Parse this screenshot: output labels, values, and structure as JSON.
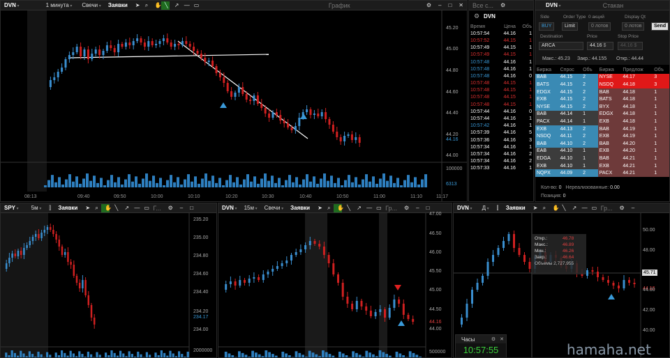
{
  "main": {
    "symbol": "DVN",
    "interval": "1 минута",
    "chart_type": "Свечи",
    "orders": "Заявки",
    "title": "График",
    "prices": [
      "45.20",
      "45.00",
      "44.80",
      "44.60",
      "44.40",
      "44.20",
      "44.00"
    ],
    "last_price": "44.16",
    "volume_labels": [
      "100000",
      "6313"
    ],
    "times": [
      "08:13",
      "09:40",
      "09:50",
      "10:00",
      "10:10",
      "10:20",
      "10:30",
      "10:40",
      "10:50",
      "11:00",
      "11:10",
      "11:17"
    ]
  },
  "tape": {
    "symbol": "DVN",
    "title": "Все с...",
    "headers": [
      "Время",
      "Цена",
      "Объ"
    ],
    "rows": [
      [
        "10:57:54",
        "44.16",
        "1",
        "w"
      ],
      [
        "10:57:52",
        "44.15",
        "1",
        "r"
      ],
      [
        "10:57:49",
        "44.15",
        "1",
        "w"
      ],
      [
        "10:57:49",
        "44.15",
        "1",
        "r"
      ],
      [
        "10:57:48",
        "44.16",
        "1",
        "b"
      ],
      [
        "10:57:48",
        "44.16",
        "1",
        "b"
      ],
      [
        "10:57:48",
        "44.16",
        "0",
        "b"
      ],
      [
        "10:57:48",
        "44.15",
        "1",
        "r"
      ],
      [
        "10:57:48",
        "44.15",
        "1",
        "r"
      ],
      [
        "10:57:48",
        "44.15",
        "1",
        "r"
      ],
      [
        "10:57:48",
        "44.15",
        "1",
        "r"
      ],
      [
        "10:57:44",
        "44.16",
        "0",
        "w"
      ],
      [
        "10:57:44",
        "44.16",
        "1",
        "w"
      ],
      [
        "10:57:42",
        "44.16",
        "1",
        "b"
      ],
      [
        "10:57:39",
        "44.16",
        "5",
        "w"
      ],
      [
        "10:57:36",
        "44.16",
        "3",
        "w"
      ],
      [
        "10:57:34",
        "44.16",
        "1",
        "w"
      ],
      [
        "10:57:34",
        "44.16",
        "2",
        "w"
      ],
      [
        "10:57:34",
        "44.16",
        "2",
        "w"
      ],
      [
        "10:57:33",
        "44.16",
        "1",
        "w"
      ]
    ]
  },
  "book": {
    "symbol": "DVN",
    "title": "Стакан",
    "order_labels": {
      "side": "Side",
      "order_type": "Order Type",
      "qty": "0 акций",
      "display": "Display Qt",
      "destination": "Destination",
      "price": "Price",
      "stop": "Stop Price"
    },
    "side": "BUY",
    "type": "Limit",
    "lots": "0 лотов",
    "lots2": "0 лотов",
    "send": "Send",
    "dest": "ARCA",
    "price": "44.16",
    "price_unit": "$",
    "stop_value": "44.16 $",
    "stats": {
      "max": "Макс.: 45.23",
      "close": "Закр.: 44.155",
      "open": "Откр.: 44.44"
    },
    "headers": [
      "Биржа",
      "Спрос",
      "Объ",
      "Биржа",
      "Предлож",
      "Объ"
    ],
    "rows": [
      [
        "BAB",
        "44.15",
        "2",
        "b",
        "NYSE",
        "44.17",
        "3",
        "r"
      ],
      [
        "BATS",
        "44.15",
        "2",
        "b",
        "NSDQ",
        "44.18",
        "3",
        "r"
      ],
      [
        "EDGX",
        "44.15",
        "2",
        "b",
        "BAB",
        "44.18",
        "1",
        "d"
      ],
      [
        "EXB",
        "44.15",
        "2",
        "b",
        "BATS",
        "44.18",
        "1",
        "d"
      ],
      [
        "NYSE",
        "44.15",
        "2",
        "b",
        "BYX",
        "44.18",
        "1",
        "d"
      ],
      [
        "BAB",
        "44.14",
        "1",
        "s",
        "EDGX",
        "44.18",
        "1",
        "d"
      ],
      [
        "PACX",
        "44.14",
        "1",
        "s",
        "EXB",
        "44.18",
        "1",
        "d"
      ],
      [
        "EXB",
        "44.13",
        "2",
        "b",
        "BAB",
        "44.19",
        "1",
        "d"
      ],
      [
        "NSDQ",
        "44.11",
        "2",
        "b",
        "EXB",
        "44.19",
        "1",
        "d"
      ],
      [
        "BAB",
        "44.10",
        "2",
        "b",
        "BAB",
        "44.20",
        "1",
        "d"
      ],
      [
        "EAB",
        "44.10",
        "1",
        "s",
        "EXB",
        "44.20",
        "1",
        "d"
      ],
      [
        "EDGA",
        "44.10",
        "1",
        "s",
        "BAB",
        "44.21",
        "1",
        "d"
      ],
      [
        "EXB",
        "44.10",
        "1",
        "s",
        "EXB",
        "44.21",
        "1",
        "d"
      ],
      [
        "NQPX",
        "44.09",
        "2",
        "b",
        "PACX",
        "44.21",
        "1",
        "d"
      ]
    ],
    "footer1": "Кол-во:",
    "footer1v": "0",
    "footer2": "Нереализованные:",
    "footer2v": "0.00",
    "footer3": "Позиция:",
    "footer3v": "0"
  },
  "spy": {
    "symbol": "SPY",
    "interval": "5м",
    "orders": "Заявки",
    "title": "Г...",
    "prices": [
      "235.20",
      "235.00",
      "234.80",
      "234.60",
      "234.40",
      "234.20",
      "234.00"
    ],
    "last": "234.17",
    "vol": "2000000"
  },
  "dvn15": {
    "symbol": "DVN",
    "interval": "15м",
    "chart_type": "Свечи",
    "orders": "Заявки",
    "title": "Гр...",
    "prices": [
      "47.00",
      "46.50",
      "46.00",
      "45.50",
      "45.00",
      "44.50",
      "44.00"
    ],
    "last": "44.16",
    "vol": "500000"
  },
  "dvnd": {
    "symbol": "DVN",
    "interval": "Д",
    "orders": "Заявки",
    "title": "Гр...",
    "prices": [
      "50.00",
      "48.00",
      "46.00",
      "44.00",
      "42.00",
      "40.00"
    ],
    "marker": "45.71",
    "last": "44.16",
    "tooltip": {
      "open_l": "Откр.:",
      "open": "46.78",
      "high_l": "Макс.:",
      "high": "46.89",
      "low_l": "Мин.:",
      "low": "46.26",
      "close_l": "Закр.:",
      "close": "46.64",
      "vol": "Объемы  2,727,955"
    }
  },
  "clock": {
    "title": "Часы",
    "time": "10:57:55"
  },
  "watermark": "hamaha.net"
}
